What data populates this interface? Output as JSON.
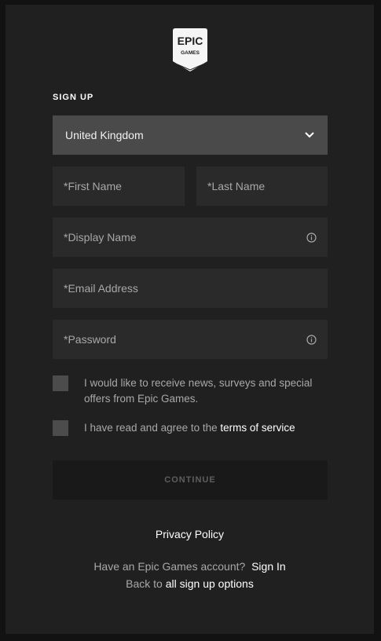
{
  "logo": {
    "line1": "EPIC",
    "line2": "GAMES"
  },
  "signup": {
    "title": "SIGN UP"
  },
  "country": {
    "selected": "United Kingdom"
  },
  "fields": {
    "first_name": {
      "placeholder": "*First Name"
    },
    "last_name": {
      "placeholder": "*Last Name"
    },
    "display_name": {
      "placeholder": "*Display Name"
    },
    "email": {
      "placeholder": "*Email Address"
    },
    "password": {
      "placeholder": "*Password"
    }
  },
  "checkboxes": {
    "news": {
      "label": "I would like to receive news, surveys and special offers from Epic Games."
    },
    "terms": {
      "prefix": "I have read and agree to the ",
      "link": "terms of service"
    }
  },
  "continue_label": "CONTINUE",
  "footer": {
    "privacy": "Privacy Policy",
    "have_account": "Have an Epic Games account?",
    "sign_in": "Sign In",
    "back_prefix": "Back to ",
    "back_link": "all sign up options"
  },
  "icons": {
    "logo": "epic-games-logo",
    "country_dropdown": "chevron-down-icon",
    "display_name_info": "info-icon",
    "password_info": "info-icon"
  },
  "colors": {
    "page_background": "#121212",
    "panel_background": "#202020",
    "select_background": "#4a4a4a",
    "field_background": "#2a2a2a",
    "checkbox": "#4c4c4c",
    "continue_background": "#191919",
    "muted_text": "#a8a8a8"
  }
}
